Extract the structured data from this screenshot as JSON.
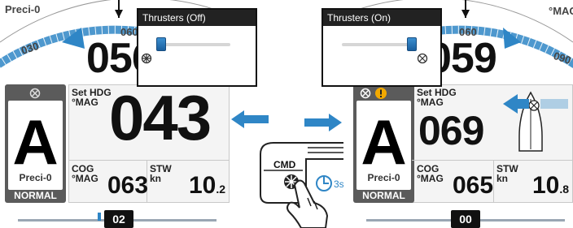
{
  "left_screen": {
    "mode_source_top": "Preci-0",
    "compass_numbers": [
      "030",
      "060"
    ],
    "heading": "056",
    "set_hdg_label": "Set HDG",
    "set_hdg_unit": "°MAG",
    "set_hdg_value": "043",
    "mode": {
      "letter": "A",
      "source": "Preci-0",
      "status": "NORMAL"
    },
    "cog": {
      "label": "COG",
      "unit": "°MAG",
      "value": "063"
    },
    "stw": {
      "label": "STW",
      "unit": "kn",
      "value_int": "10",
      "value_dec": ".2"
    },
    "rudder": "02",
    "popup": {
      "title": "Thrusters (Off)",
      "slider_fraction": 0.05
    }
  },
  "right_screen": {
    "compass_numbers": [
      "060",
      "°MAG",
      "090"
    ],
    "heading": "059",
    "set_hdg_label": "Set HDG",
    "set_hdg_unit": "°MAG",
    "set_hdg_value": "069",
    "mode": {
      "letter": "A",
      "source": "Preci-0",
      "status": "NORMAL"
    },
    "cog": {
      "label": "COG",
      "unit": "°MAG",
      "value": "065"
    },
    "stw": {
      "label": "STW",
      "unit": "kn",
      "value_int": "10",
      "value_dec": ".8"
    },
    "rudder": "00",
    "popup": {
      "title": "Thrusters (On)",
      "slider_fraction": 0.95
    }
  },
  "illustration": {
    "button_label": "CMD",
    "hold_time": "3s"
  },
  "colors": {
    "accent_blue": "#2f86c6",
    "mode_gray": "#5b5b5b",
    "warning": "#f2a900"
  }
}
